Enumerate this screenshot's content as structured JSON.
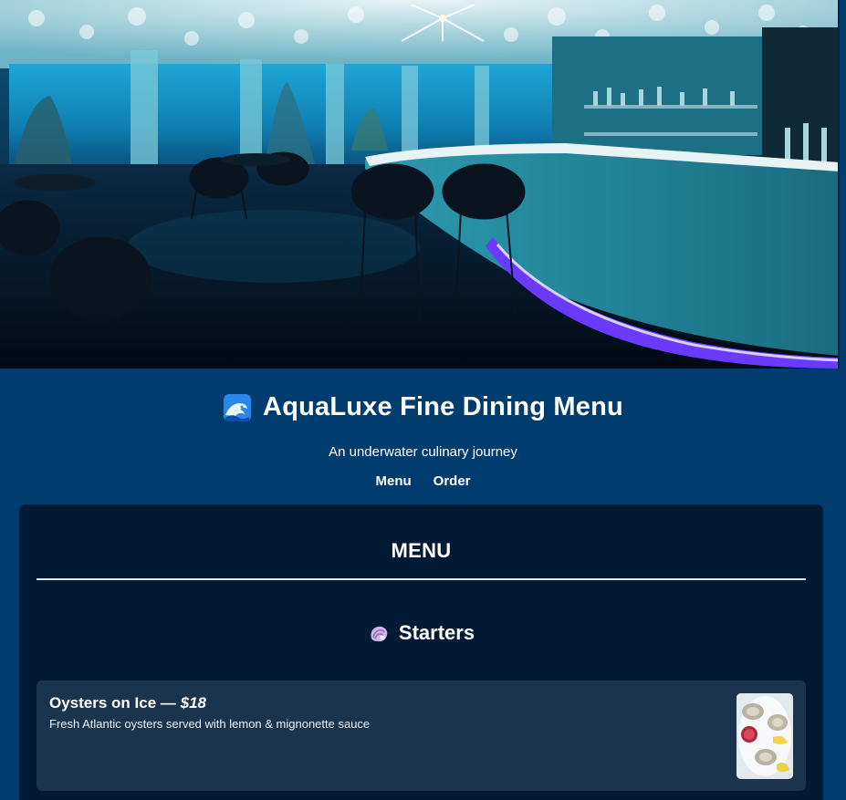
{
  "header": {
    "title": "AquaLuxe Fine Dining Menu",
    "title_icon": "wave-icon",
    "tagline": "An underwater culinary journey",
    "nav": [
      {
        "label": "Menu"
      },
      {
        "label": "Order"
      }
    ]
  },
  "hero": {
    "icon": "underwater-restaurant-photo"
  },
  "menu": {
    "heading": "MENU",
    "sections": [
      {
        "title": "Starters",
        "icon": "shell-icon",
        "items": [
          {
            "name": "Oysters on Ice",
            "separator": " — ",
            "price": "$18",
            "description": "Fresh Atlantic oysters served with lemon & mignonette sauce",
            "photo": "oysters-photo"
          }
        ]
      }
    ]
  },
  "colors": {
    "page_bg": "#003c6e",
    "panel_bg": "#021a33",
    "card_bg": "#1b344d",
    "accent_glow": "#5a2bff",
    "aqua": "#2fb7e6"
  }
}
